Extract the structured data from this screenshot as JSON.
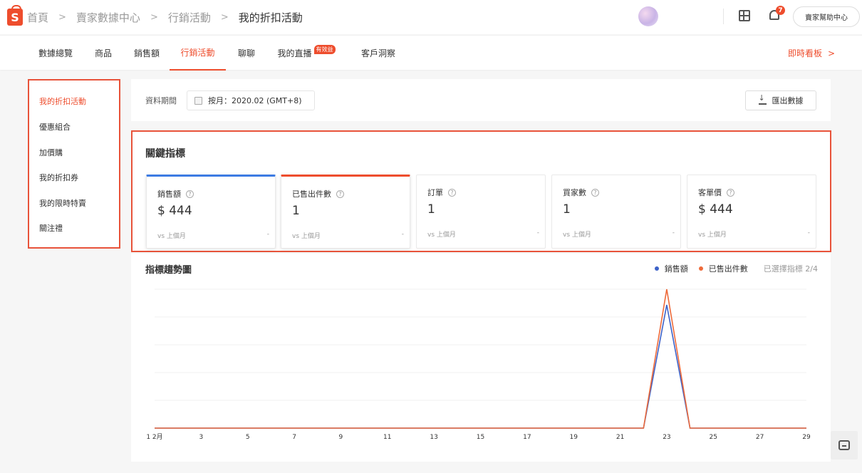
{
  "header": {
    "logo_letter": "S",
    "breadcrumbs": [
      "首頁",
      "賣家數據中心",
      "行銷活動",
      "我的折扣活動"
    ],
    "help_label": "賣家幫助中心",
    "notification_count": "7"
  },
  "tabs": {
    "items": [
      {
        "label": "數據總覽"
      },
      {
        "label": "商品"
      },
      {
        "label": "銷售額"
      },
      {
        "label": "行銷活動"
      },
      {
        "label": "聊聊"
      },
      {
        "label": "我的直播",
        "badge": "有效益"
      },
      {
        "label": "客戶洞察"
      }
    ],
    "active": "行銷活動",
    "right_link": "即時看板"
  },
  "sidebar": {
    "items": [
      "我的折扣活動",
      "優惠組合",
      "加價購",
      "我的折扣券",
      "我的限時特賣",
      "關注禮"
    ],
    "active": "我的折扣活動"
  },
  "filter": {
    "label": "資料期間",
    "date_text": "按月：2020.02 (GMT+8)",
    "export_label": "匯出數據"
  },
  "kpi": {
    "title": "關鍵指標",
    "cards": [
      {
        "label": "銷售額",
        "value": "$ 444",
        "compare": "vs 上個月",
        "trend": "-",
        "accent": "#3d7be3"
      },
      {
        "label": "已售出件數",
        "value": "1",
        "compare": "vs 上個月",
        "trend": "-",
        "accent": "#ee4d2d"
      },
      {
        "label": "訂單",
        "value": "1",
        "compare": "vs 上個月",
        "trend": "-",
        "accent": ""
      },
      {
        "label": "買家數",
        "value": "1",
        "compare": "vs 上個月",
        "trend": "-",
        "accent": ""
      },
      {
        "label": "客單價",
        "value": "$ 444",
        "compare": "vs 上個月",
        "trend": "-",
        "accent": ""
      }
    ]
  },
  "trend": {
    "title": "指標趨勢圖",
    "legend_note": "已選擇指標 2/4"
  },
  "chart_data": {
    "type": "line",
    "x": [
      "1 2月",
      "2",
      "3",
      "4",
      "5",
      "6",
      "7",
      "8",
      "9",
      "10",
      "11",
      "12",
      "13",
      "14",
      "15",
      "16",
      "17",
      "18",
      "19",
      "20",
      "21",
      "22",
      "23",
      "24",
      "25",
      "26",
      "27",
      "28",
      "29"
    ],
    "x_tick_labels": [
      "1 2月",
      "3",
      "5",
      "7",
      "9",
      "11",
      "13",
      "15",
      "17",
      "19",
      "21",
      "23",
      "25",
      "27",
      "29"
    ],
    "series": [
      {
        "name": "銷售額",
        "color": "#3d62c8",
        "values": [
          0,
          0,
          0,
          0,
          0,
          0,
          0,
          0,
          0,
          0,
          0,
          0,
          0,
          0,
          0,
          0,
          0,
          0,
          0,
          0,
          0,
          0,
          444,
          0,
          0,
          0,
          0,
          0,
          0
        ]
      },
      {
        "name": "已售出件數",
        "color": "#ee6a3a",
        "values": [
          0,
          0,
          0,
          0,
          0,
          0,
          0,
          0,
          0,
          0,
          0,
          0,
          0,
          0,
          0,
          0,
          0,
          0,
          0,
          0,
          0,
          0,
          1,
          0,
          0,
          0,
          0,
          0,
          0
        ]
      }
    ],
    "grid": true,
    "legend_position": "top-right"
  }
}
